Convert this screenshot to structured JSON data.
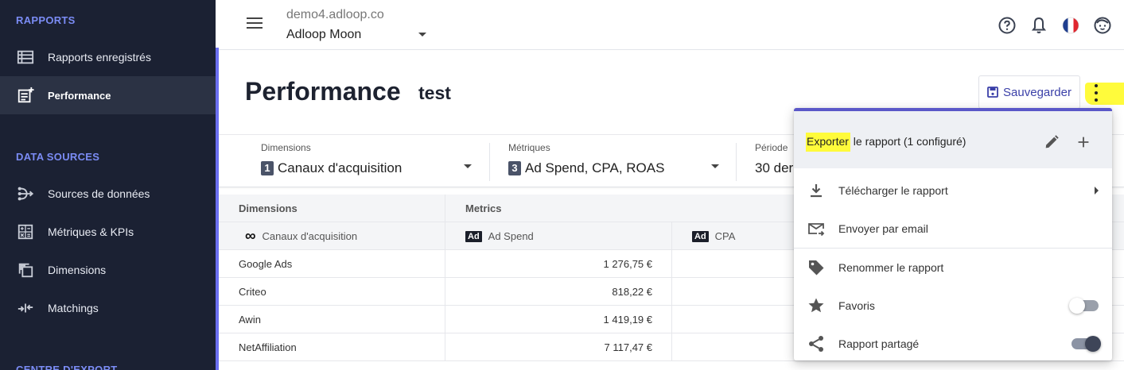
{
  "sidebar": {
    "sections": [
      {
        "title": "RAPPORTS"
      },
      {
        "title": "DATA SOURCES"
      },
      {
        "title": "CENTRE D'EXPORT"
      }
    ],
    "items": [
      {
        "label": "Rapports enregistrés",
        "icon": "list-icon",
        "active": false
      },
      {
        "label": "Performance",
        "icon": "report-add-icon",
        "active": true
      },
      {
        "label": "Sources de données",
        "icon": "data-source-icon",
        "active": false
      },
      {
        "label": "Métriques & KPIs",
        "icon": "calculator-icon",
        "active": false
      },
      {
        "label": "Dimensions",
        "icon": "layers-icon",
        "active": false
      },
      {
        "label": "Matchings",
        "icon": "merge-arrows-icon",
        "active": false
      }
    ]
  },
  "topbar": {
    "domain": "demo4.adloop.co",
    "account": "Adloop Moon",
    "icons": [
      "help-icon",
      "bell-icon",
      "french-flag-icon",
      "user-face-icon"
    ]
  },
  "page": {
    "title": "Performance",
    "subtitle": "test",
    "save_label": "Sauvegarder"
  },
  "filters": [
    {
      "label": "Dimensions",
      "count": "1",
      "value": "Canaux d'acquisition"
    },
    {
      "label": "Métriques",
      "count": "3",
      "value": "Ad Spend, CPA, ROAS"
    },
    {
      "label": "Période",
      "value": "30 der"
    }
  ],
  "table": {
    "group_headers": [
      "Dimensions",
      "Metrics"
    ],
    "column_headers": [
      {
        "label": "Canaux d'acquisition",
        "badge": "∞"
      },
      {
        "label": "Ad Spend",
        "badge": "Ad"
      },
      {
        "label": "CPA",
        "badge": "Ad"
      }
    ],
    "rows": [
      {
        "channel": "Google Ads",
        "ad_spend": "1 276,75 €"
      },
      {
        "channel": "Criteo",
        "ad_spend": "818,22 €"
      },
      {
        "channel": "Awin",
        "ad_spend": "1 419,19 €"
      },
      {
        "channel": "NetAffiliation",
        "ad_spend": "7 117,47 €"
      }
    ]
  },
  "menu": {
    "header_highlight": "Exporter",
    "header_rest": " le rapport (1 configuré)",
    "items": [
      {
        "label": "Télécharger le rapport",
        "icon": "download-icon"
      },
      {
        "label": "Envoyer par email",
        "icon": "email-send-icon"
      },
      {
        "label": "Renommer le rapport",
        "icon": "tag-icon"
      },
      {
        "label": "Favoris",
        "icon": "star-icon",
        "toggle": false
      },
      {
        "label": "Rapport partagé",
        "icon": "share-icon",
        "toggle": true
      }
    ]
  },
  "colors": {
    "sidebar_bg": "#1b2133",
    "sidebar_accent": "#6b6ff0",
    "section_title": "#7b8cf5",
    "menu_accent": "#5a57c8",
    "highlight": "#fffb3b"
  }
}
